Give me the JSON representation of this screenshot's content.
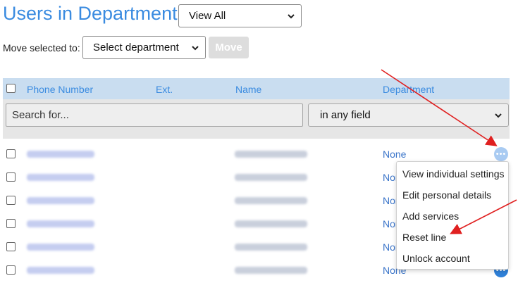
{
  "header": {
    "title": "Users in Department:",
    "view_select": "View All"
  },
  "move": {
    "label": "Move selected to:",
    "department_select": "Select department",
    "move_button": "Move"
  },
  "table": {
    "columns": {
      "phone": "Phone Number",
      "ext": "Ext.",
      "name": "Name",
      "department": "Department"
    },
    "search_placeholder": "Search for...",
    "field_select": "in any field",
    "rows": [
      {
        "department": "None"
      },
      {
        "department": "None"
      },
      {
        "department": "None"
      },
      {
        "department": "None"
      },
      {
        "department": "None"
      },
      {
        "department": "None"
      }
    ]
  },
  "context_menu": {
    "items": [
      "View individual settings",
      "Edit personal details",
      "Add services",
      "Reset line",
      "Unlock account"
    ]
  },
  "colors": {
    "accent": "#3a8be0",
    "header_bg": "#c9ddf0",
    "arrow": "#e02020",
    "more_active": "#a9cbf2",
    "more_default": "#2f80d8"
  },
  "icons": {
    "more": "more-icon",
    "chevron": "chevron-down-icon"
  }
}
